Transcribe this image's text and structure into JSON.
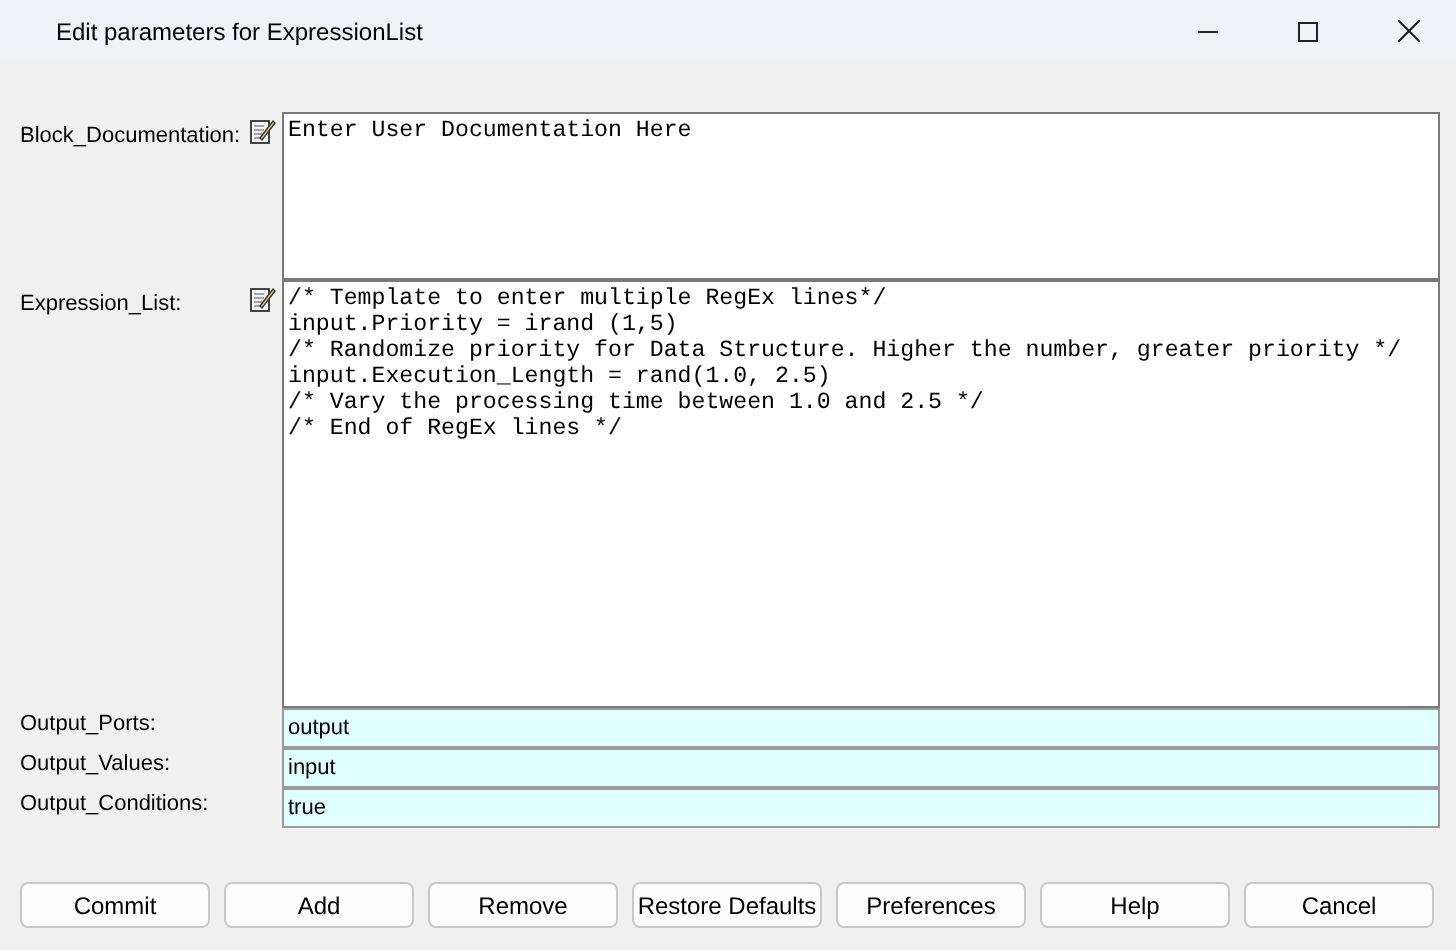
{
  "window": {
    "title": "Edit parameters for ExpressionList"
  },
  "text_fields": [
    {
      "label": "Block_Documentation:",
      "lines": [
        "Enter User Documentation Here"
      ]
    },
    {
      "label": "Expression_List:",
      "lines": [
        "/* Template to enter multiple RegEx lines*/",
        "input.Priority = irand (1,5)",
        "/* Randomize priority for Data Structure. Higher the number, greater priority */",
        "input.Execution_Length = rand(1.0, 2.5)",
        "/* Vary the processing time between 1.0 and 2.5 */",
        "/* End of RegEx lines */"
      ]
    }
  ],
  "fields": [
    {
      "label": "Output_Ports:",
      "value": "output"
    },
    {
      "label": "Output_Values:",
      "value": "input"
    },
    {
      "label": "Output_Conditions:",
      "value": "true"
    }
  ],
  "buttons": [
    "Commit",
    "Add",
    "Remove",
    "Restore Defaults",
    "Preferences",
    "Help",
    "Cancel"
  ]
}
